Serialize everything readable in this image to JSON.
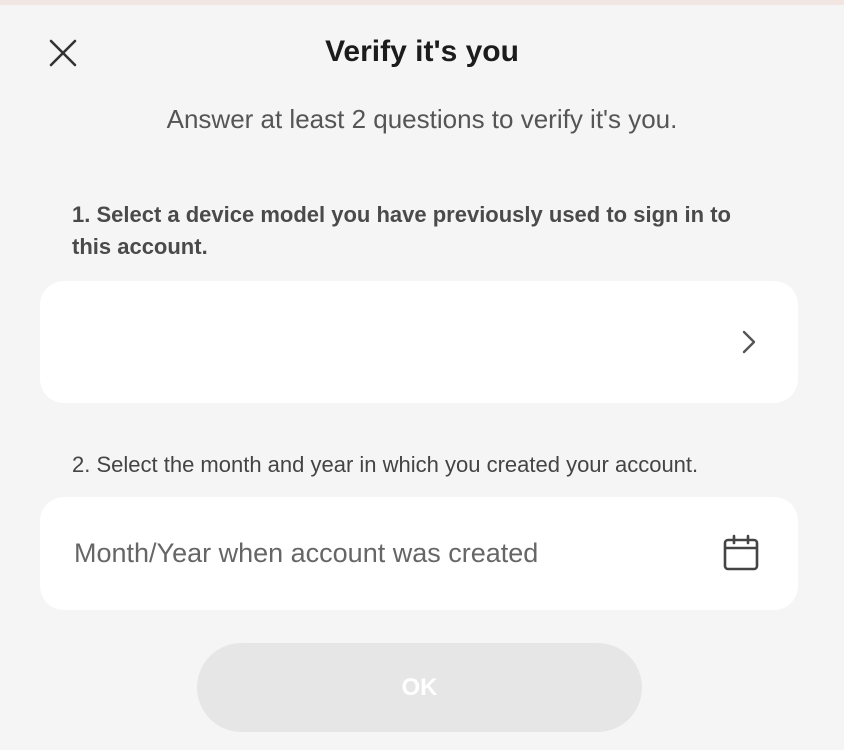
{
  "dialog": {
    "title": "Verify it's you",
    "subtitle": "Answer at least 2 questions to verify it's you."
  },
  "questions": [
    {
      "label": "1. Select a device model you have previously used to sign in to this account.",
      "value": "",
      "icon": "chevron-right-icon"
    },
    {
      "label": "2. Select the month and year in which you created your account.",
      "placeholder": "Month/Year when account was created",
      "icon": "calendar-icon"
    }
  ],
  "actions": {
    "ok_label": "OK",
    "ok_enabled": false
  },
  "colors": {
    "background": "#f5f5f5",
    "card": "#ffffff",
    "button_disabled": "#e6e6e6"
  }
}
